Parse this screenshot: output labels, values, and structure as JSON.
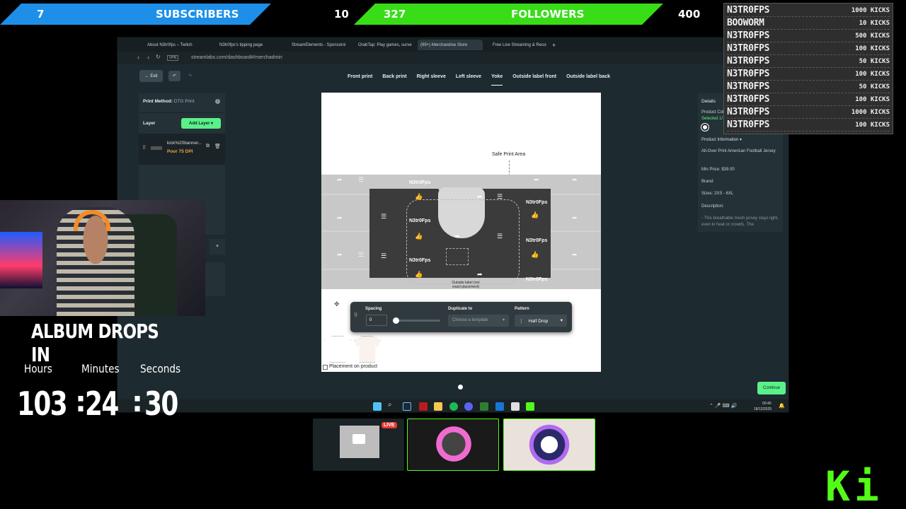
{
  "goals": {
    "subs_current": "7",
    "subs_label": "SUBSCRIBERS",
    "subs_target": "10",
    "followers_current": "327",
    "followers_label": "FOLLOWERS",
    "followers_target": "400"
  },
  "donations": [
    {
      "name": "N3TR0FPS",
      "amount": "1000 KICKS"
    },
    {
      "name": "BOOWORM",
      "amount": "10 KICKS"
    },
    {
      "name": "N3TR0FPS",
      "amount": "500 KICKS"
    },
    {
      "name": "N3TR0FPS",
      "amount": "100 KICKS"
    },
    {
      "name": "N3TR0FPS",
      "amount": "50 KICKS"
    },
    {
      "name": "N3TR0FPS",
      "amount": "100 KICKS"
    },
    {
      "name": "N3TR0FPS",
      "amount": "50 KICKS"
    },
    {
      "name": "N3TR0FPS",
      "amount": "100 KICKS"
    },
    {
      "name": "N3TR0FPS",
      "amount": "1000 KICKS"
    },
    {
      "name": "N3TR0FPS",
      "amount": "100 KICKS"
    }
  ],
  "browser": {
    "tabs": [
      "About N3tr0fps – Twitch",
      "N3tr0fps's tipping page",
      "StreamElements - Sponsorships",
      "OrabTap: Play games, surveys",
      "(99+) Merchandise Store",
      "Free Live Streaming & Recording"
    ],
    "url": "streamlabs.com/dashboard#/merchadmin",
    "vpn": "VPN"
  },
  "merch": {
    "exit": "Exit",
    "print_tabs": [
      "Front print",
      "Back print",
      "Right sleeve",
      "Left sleeve",
      "Yoke",
      "Outside label front",
      "Outside label back"
    ],
    "active_tab": "Yoke",
    "print_method_label": "Print Method:",
    "print_method_value": "DTG Print",
    "layer_label": "Layer",
    "add_layer": "Add Layer",
    "layer_name": "kick%20banner...",
    "layer_quality": "Poor 75 DPI",
    "safe_area": "Safe Print Area",
    "watermark": "N3tr0Fps",
    "outside_label": "Outside label (not exact placement)",
    "spacing_label": "Spacing",
    "spacing_value": "0",
    "duplicate_label": "Duplicate to",
    "duplicate_placeholder": "Choose a template",
    "pattern_label": "Pattern",
    "pattern_value": "Half Drop",
    "placement_label": "Placement on product",
    "details": "Details",
    "product_color": "Product Color",
    "selected": "Selected 1/1",
    "product_info": "Product Information",
    "product_name": "All-Over Print American Football Jersey",
    "min_price": "Min Price: $39.00",
    "brand": "Brand:",
    "sizes": "Sizes: 2XS - 6XL",
    "description": "Description:",
    "desc_text": "- This breathable mesh jersey stays light, even in heat or crowds. The",
    "continue": "Continue"
  },
  "taskbar": {
    "time": "00:40",
    "date": "18/12/2025"
  },
  "album": {
    "title": "ALBUM DROPS IN",
    "hours_label": "Hours",
    "minutes_label": "Minutes",
    "seconds_label": "Seconds",
    "hours": "103",
    "minutes": "24",
    "seconds": "30",
    "sep": ":"
  },
  "thumbs": {
    "live": "LIVE"
  },
  "kick_logo": "Ki",
  "colors": {
    "subs": "#1e88e5",
    "followers": "#3ddc1a",
    "kick": "#53fc18",
    "accent": "#5af08a"
  }
}
